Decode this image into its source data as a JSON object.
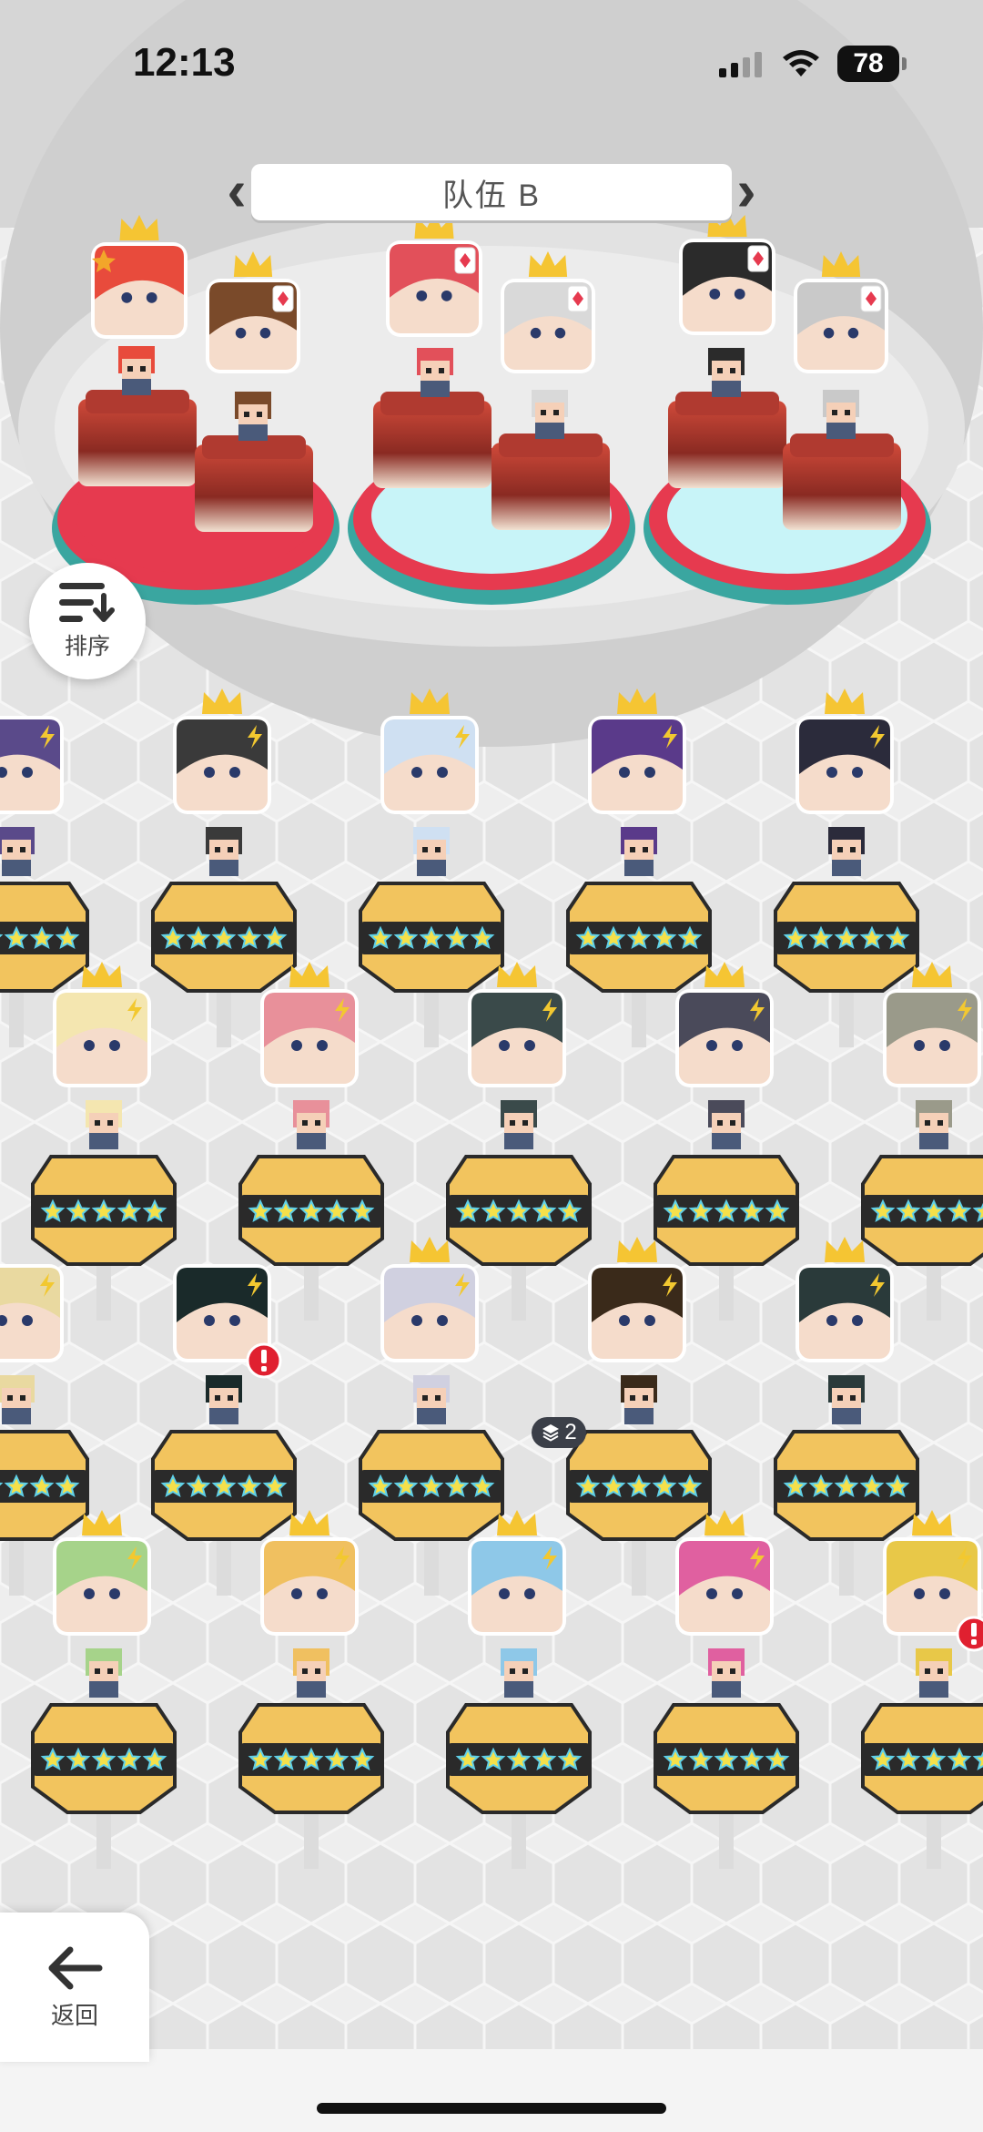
{
  "status_bar": {
    "time": "12:13",
    "battery": "78"
  },
  "team": {
    "name": "队伍 B"
  },
  "buttons": {
    "sort_label": "排序",
    "back_label": "返回"
  },
  "hero_badge": {
    "stack_count": "2"
  },
  "colors": {
    "crown": "#f5c533",
    "card_red": "#e63a4f",
    "pedestal_gold": "#f2c45e",
    "pedestal_dark": "#2a2a2a",
    "alert_red": "#e02030",
    "lightning": "#f2c830"
  },
  "squad_slots": [
    {
      "name": "slot-1",
      "hair": "#e84b3c",
      "rarity_icon": "star"
    },
    {
      "name": "slot-2",
      "hair": "#7a4a2a",
      "rarity_icon": "card"
    },
    {
      "name": "slot-3",
      "hair": "#e2505a",
      "rarity_icon": "card"
    },
    {
      "name": "slot-4",
      "hair": "#d9d9d9",
      "rarity_icon": "card"
    },
    {
      "name": "slot-5",
      "hair": "#2b2b2b",
      "rarity_icon": "card"
    },
    {
      "name": "slot-6",
      "hair": "#c9c9c9",
      "rarity_icon": "card"
    }
  ],
  "roster": [
    {
      "hair": "#5a4a8a",
      "stars": 5,
      "crown": false,
      "alert": false
    },
    {
      "hair": "#3a3a3a",
      "stars": 5,
      "crown": true,
      "alert": false
    },
    {
      "hair": "#cfe0f2",
      "stars": 5,
      "crown": true,
      "alert": false
    },
    {
      "hair": "#5a3a8a",
      "stars": 5,
      "crown": true,
      "alert": false
    },
    {
      "hair": "#2b2b3b",
      "stars": 5,
      "crown": true,
      "alert": false
    },
    {
      "hair": "#f4e6b0",
      "stars": 5,
      "crown": true,
      "alert": false
    },
    {
      "hair": "#e8909a",
      "stars": 5,
      "crown": true,
      "alert": false
    },
    {
      "hair": "#3a4a4a",
      "stars": 5,
      "crown": true,
      "alert": false
    },
    {
      "hair": "#4a4a5a",
      "stars": 5,
      "crown": true,
      "alert": false
    },
    {
      "hair": "#9a9a8a",
      "stars": 5,
      "crown": true,
      "alert": false
    },
    {
      "hair": "#e9d9a0",
      "stars": 5,
      "crown": false,
      "alert": false
    },
    {
      "hair": "#1a2a2a",
      "stars": 5,
      "crown": false,
      "alert": true
    },
    {
      "hair": "#d0d0e0",
      "stars": 5,
      "crown": true,
      "alert": false
    },
    {
      "hair": "#3a2a1a",
      "stars": 5,
      "crown": true,
      "alert": false
    },
    {
      "hair": "#2a3a3a",
      "stars": 5,
      "crown": true,
      "alert": false
    },
    {
      "hair": "#a6d38a",
      "stars": 5,
      "crown": true,
      "alert": false
    },
    {
      "hair": "#f0c060",
      "stars": 5,
      "crown": true,
      "alert": false
    },
    {
      "hair": "#8ec8e8",
      "stars": 5,
      "crown": true,
      "alert": false
    },
    {
      "hair": "#e060a0",
      "stars": 5,
      "crown": true,
      "alert": false
    },
    {
      "hair": "#e8c848",
      "stars": 5,
      "crown": true,
      "alert": true
    }
  ]
}
